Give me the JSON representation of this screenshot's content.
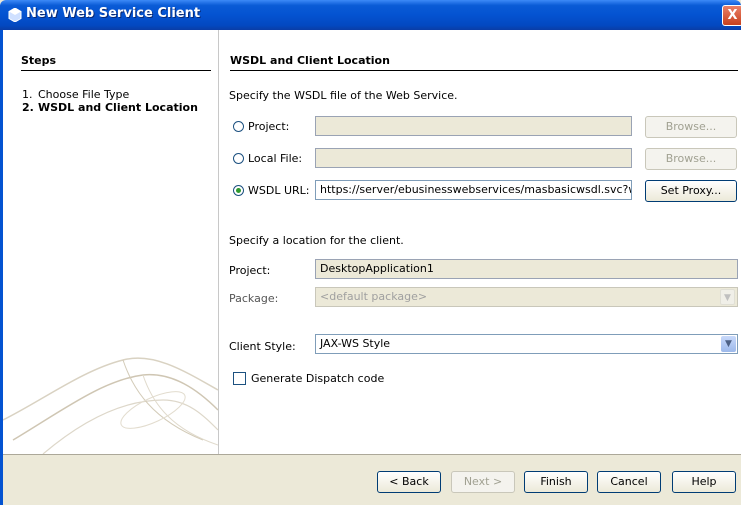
{
  "window": {
    "title": "New Web Service Client",
    "close_label": "X"
  },
  "steps": {
    "title": "Steps",
    "items": [
      {
        "num": "1.",
        "label": "Choose File Type"
      },
      {
        "num": "2.",
        "label": "WSDL and Client Location"
      }
    ]
  },
  "panel": {
    "title": "WSDL and Client Location",
    "wsdl_instruction": "Specify the WSDL file of the Web Service.",
    "project_radio": {
      "label": "Project:",
      "selected": false,
      "value": "",
      "browse_label": "Browse..."
    },
    "local_file_radio": {
      "label": "Local File:",
      "selected": false,
      "value": "",
      "browse_label": "Browse..."
    },
    "wsdl_url_radio": {
      "label": "WSDL URL:",
      "selected": true,
      "value": "https://server/ebusinesswebservices/masbasicwsdl.svc?wsdl",
      "proxy_label": "Set Proxy..."
    },
    "location_instruction": "Specify a location for the client.",
    "project": {
      "label": "Project:",
      "value": "DesktopApplication1"
    },
    "package": {
      "label": "Package:",
      "value": "<default package>"
    },
    "client_style": {
      "label": "Client Style:",
      "value": "JAX-WS Style"
    },
    "dispatch": {
      "label": "Generate Dispatch code",
      "checked": false
    }
  },
  "buttons": {
    "back": "< Back",
    "next": "Next >",
    "finish": "Finish",
    "cancel": "Cancel",
    "help": "Help"
  },
  "colors": {
    "title_bar": "#0453d1",
    "dialog_bg": "#ece9d8",
    "radio_dot": "#2f9a2f"
  }
}
